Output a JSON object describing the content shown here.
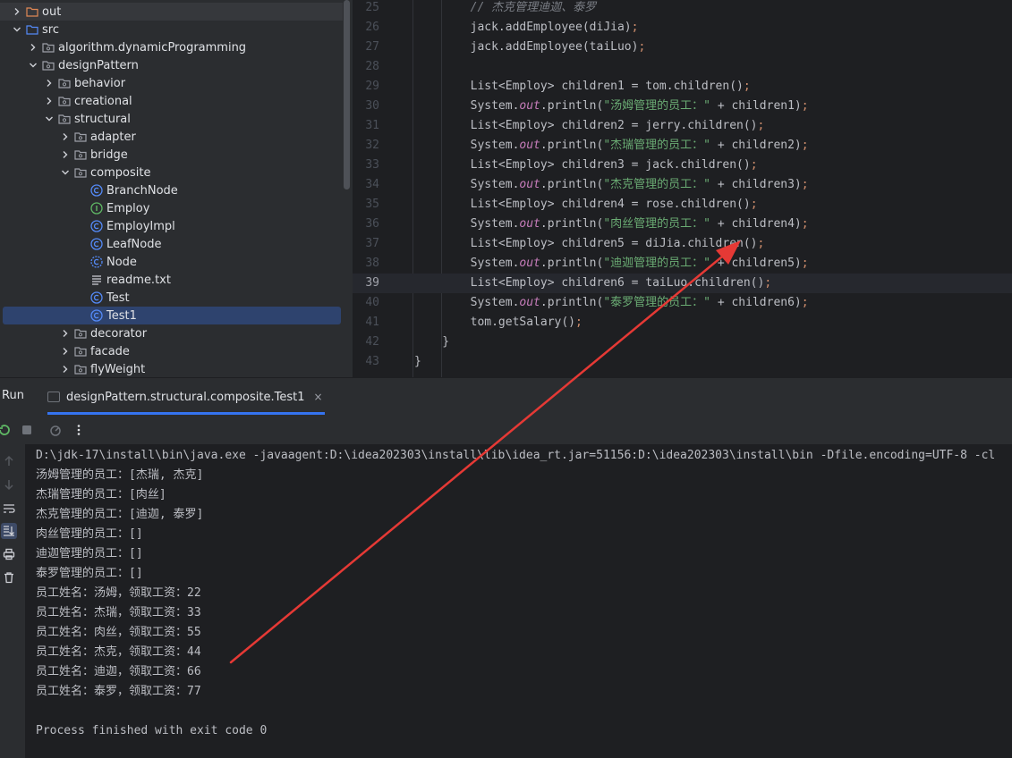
{
  "colors": {
    "accent": "#3574f0",
    "annotation_arrow": "#e53935",
    "selection": "#2e436e"
  },
  "project_tree": [
    {
      "label": "out",
      "indent": 0,
      "chevron": "right",
      "icon": "folder-orange-icon"
    },
    {
      "label": "src",
      "indent": 0,
      "chevron": "down",
      "icon": "folder-blue-icon"
    },
    {
      "label": "algorithm.dynamicProgramming",
      "indent": 1,
      "chevron": "right",
      "icon": "package-icon"
    },
    {
      "label": "designPattern",
      "indent": 1,
      "chevron": "down",
      "icon": "package-icon"
    },
    {
      "label": "behavior",
      "indent": 2,
      "chevron": "right",
      "icon": "package-icon"
    },
    {
      "label": "creational",
      "indent": 2,
      "chevron": "right",
      "icon": "package-icon"
    },
    {
      "label": "structural",
      "indent": 2,
      "chevron": "down",
      "icon": "package-icon"
    },
    {
      "label": "adapter",
      "indent": 3,
      "chevron": "right",
      "icon": "package-icon"
    },
    {
      "label": "bridge",
      "indent": 3,
      "chevron": "right",
      "icon": "package-icon"
    },
    {
      "label": "composite",
      "indent": 3,
      "chevron": "down",
      "icon": "package-icon"
    },
    {
      "label": "BranchNode",
      "indent": 4,
      "chevron": "none",
      "icon": "class-icon"
    },
    {
      "label": "Employ",
      "indent": 4,
      "chevron": "none",
      "icon": "interface-icon"
    },
    {
      "label": "EmployImpl",
      "indent": 4,
      "chevron": "none",
      "icon": "class-icon"
    },
    {
      "label": "LeafNode",
      "indent": 4,
      "chevron": "none",
      "icon": "class-icon"
    },
    {
      "label": "Node",
      "indent": 4,
      "chevron": "none",
      "icon": "abstract-class-icon"
    },
    {
      "label": "readme.txt",
      "indent": 4,
      "chevron": "none",
      "icon": "text-file-icon"
    },
    {
      "label": "Test",
      "indent": 4,
      "chevron": "none",
      "icon": "class-icon"
    },
    {
      "label": "Test1",
      "indent": 4,
      "chevron": "none",
      "icon": "class-icon",
      "selected": true
    },
    {
      "label": "decorator",
      "indent": 3,
      "chevron": "right",
      "icon": "package-icon"
    },
    {
      "label": "facade",
      "indent": 3,
      "chevron": "right",
      "icon": "package-icon"
    },
    {
      "label": "flyWeight",
      "indent": 3,
      "chevron": "right",
      "icon": "package-icon"
    }
  ],
  "editor": {
    "current_line": "39",
    "lines": [
      {
        "n": "25",
        "tokens": [
          {
            "t": "        // 杰克管理迪迦、泰罗",
            "c": "cmt"
          }
        ]
      },
      {
        "n": "26",
        "tokens": [
          {
            "t": "        jack.addEmployee(diJia)"
          },
          {
            "t": ";",
            "c": "kw"
          }
        ]
      },
      {
        "n": "27",
        "tokens": [
          {
            "t": "        jack.addEmployee(taiLuo)"
          },
          {
            "t": ";",
            "c": "kw"
          }
        ]
      },
      {
        "n": "28",
        "tokens": []
      },
      {
        "n": "29",
        "tokens": [
          {
            "t": "        List<Employ> children1 = tom.children()"
          },
          {
            "t": ";",
            "c": "kw"
          }
        ]
      },
      {
        "n": "30",
        "tokens": [
          {
            "t": "        System."
          },
          {
            "t": "out",
            "c": "field"
          },
          {
            "t": ".println("
          },
          {
            "t": "\"汤姆管理的员工：\"",
            "c": "str"
          },
          {
            "t": " + children1)"
          },
          {
            "t": ";",
            "c": "kw"
          }
        ]
      },
      {
        "n": "31",
        "tokens": [
          {
            "t": "        List<Employ> children2 = jerry.children()"
          },
          {
            "t": ";",
            "c": "kw"
          }
        ]
      },
      {
        "n": "32",
        "tokens": [
          {
            "t": "        System."
          },
          {
            "t": "out",
            "c": "field"
          },
          {
            "t": ".println("
          },
          {
            "t": "\"杰瑞管理的员工：\"",
            "c": "str"
          },
          {
            "t": " + children2)"
          },
          {
            "t": ";",
            "c": "kw"
          }
        ]
      },
      {
        "n": "33",
        "tokens": [
          {
            "t": "        List<Employ> children3 = jack.children()"
          },
          {
            "t": ";",
            "c": "kw"
          }
        ]
      },
      {
        "n": "34",
        "tokens": [
          {
            "t": "        System."
          },
          {
            "t": "out",
            "c": "field"
          },
          {
            "t": ".println("
          },
          {
            "t": "\"杰克管理的员工：\"",
            "c": "str"
          },
          {
            "t": " + children3)"
          },
          {
            "t": ";",
            "c": "kw"
          }
        ]
      },
      {
        "n": "35",
        "tokens": [
          {
            "t": "        List<Employ> children4 = rose.children()"
          },
          {
            "t": ";",
            "c": "kw"
          }
        ]
      },
      {
        "n": "36",
        "tokens": [
          {
            "t": "        System."
          },
          {
            "t": "out",
            "c": "field"
          },
          {
            "t": ".println("
          },
          {
            "t": "\"肉丝管理的员工：\"",
            "c": "str"
          },
          {
            "t": " + children4)"
          },
          {
            "t": ";",
            "c": "kw"
          }
        ]
      },
      {
        "n": "37",
        "tokens": [
          {
            "t": "        List<Employ> children5 = diJia.children()"
          },
          {
            "t": ";",
            "c": "kw"
          }
        ]
      },
      {
        "n": "38",
        "tokens": [
          {
            "t": "        System."
          },
          {
            "t": "out",
            "c": "field"
          },
          {
            "t": ".println("
          },
          {
            "t": "\"迪迦管理的员工：\"",
            "c": "str"
          },
          {
            "t": " + children5)"
          },
          {
            "t": ";",
            "c": "kw"
          }
        ]
      },
      {
        "n": "39",
        "tokens": [
          {
            "t": "        List<Employ> children6 = taiLuo.children()"
          },
          {
            "t": ";",
            "c": "kw"
          }
        ]
      },
      {
        "n": "40",
        "tokens": [
          {
            "t": "        System."
          },
          {
            "t": "out",
            "c": "field"
          },
          {
            "t": ".println("
          },
          {
            "t": "\"泰罗管理的员工：\"",
            "c": "str"
          },
          {
            "t": " + children6)"
          },
          {
            "t": ";",
            "c": "kw"
          }
        ]
      },
      {
        "n": "41",
        "tokens": [
          {
            "t": "        tom.getSalary()"
          },
          {
            "t": ";",
            "c": "kw"
          }
        ]
      },
      {
        "n": "42",
        "tokens": [
          {
            "t": "    }"
          }
        ]
      },
      {
        "n": "43",
        "tokens": [
          {
            "t": "}"
          }
        ]
      }
    ]
  },
  "run_panel": {
    "title": "Run",
    "tab_label": "designPattern.structural.composite.Test1",
    "tab_close": "×"
  },
  "console_lines": [
    "D:\\jdk-17\\install\\bin\\java.exe -javaagent:D:\\idea202303\\install\\lib\\idea_rt.jar=51156:D:\\idea202303\\install\\bin -Dfile.encoding=UTF-8 -cl",
    "汤姆管理的员工：[杰瑞, 杰克]",
    "杰瑞管理的员工：[肉丝]",
    "杰克管理的员工：[迪迦, 泰罗]",
    "肉丝管理的员工：[]",
    "迪迦管理的员工：[]",
    "泰罗管理的员工：[]",
    "员工姓名：汤姆，领取工资：22",
    "员工姓名：杰瑞，领取工资：33",
    "员工姓名：肉丝，领取工资：55",
    "员工姓名：杰克，领取工资：44",
    "员工姓名：迪迦，领取工资：66",
    "员工姓名：泰罗，领取工资：77",
    "",
    "Process finished with exit code 0"
  ]
}
